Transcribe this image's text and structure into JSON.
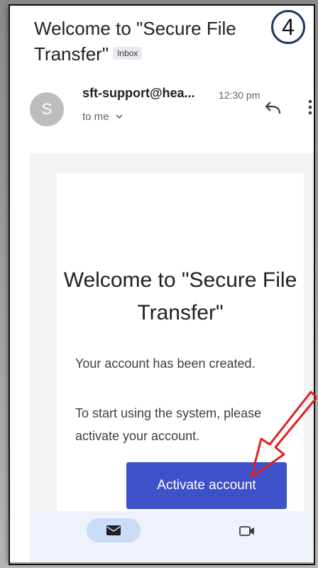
{
  "email": {
    "subject": "Welcome to \"Secure File Transfer\"",
    "label": "Inbox",
    "sender_initial": "S",
    "sender": "sft-support@hea...",
    "time": "12:30 pm",
    "recipient": "to me"
  },
  "step_badge": "4",
  "body": {
    "title": "Welcome to \"Secure File Transfer\"",
    "line1": "Your account has been created.",
    "line2": "To start using the system, please activate your account.",
    "button_label": "Activate account"
  },
  "colors": {
    "button": "#3f51c8",
    "arrow": "#e02020",
    "nav_active": "#c9dbf6"
  },
  "icons": {
    "reply": "reply-icon",
    "more": "more-vert-icon",
    "mail": "mail-icon",
    "video": "video-icon",
    "chevron": "chevron-down-icon"
  }
}
